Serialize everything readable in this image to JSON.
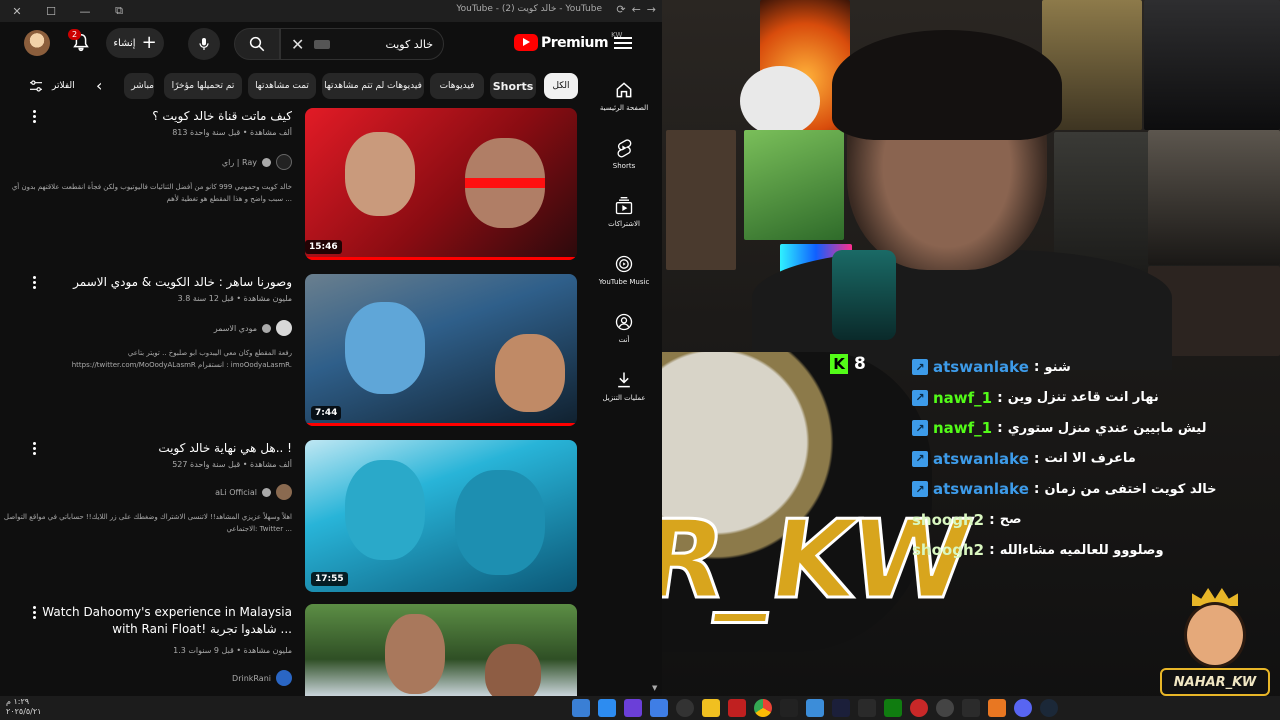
{
  "browser": {
    "window_title": "YouTube - خالد كويت (2) - YouTube"
  },
  "masthead": {
    "notification_count": "2",
    "create_label": "إنشاء",
    "search_query": "خالد كويت",
    "logo_text": "Premium",
    "logo_region": "KW"
  },
  "filters": {
    "filters_label": "الفلاتر",
    "chips": [
      "الكل",
      "Shorts",
      "فيديوهات",
      "فيديوهات لم تتم مشاهدتها",
      "تمت مشاهدتها",
      "تم تحميلها مؤخرًا",
      "مباشر"
    ]
  },
  "rail": {
    "items": [
      {
        "label": "الصفحة الرئيسية",
        "icon": "home-icon"
      },
      {
        "label": "Shorts",
        "icon": "shorts-icon"
      },
      {
        "label": "الاشتراكات",
        "icon": "subscriptions-icon"
      },
      {
        "label": "YouTube Music",
        "icon": "music-icon"
      },
      {
        "label": "أنت",
        "icon": "you-icon"
      },
      {
        "label": "عمليات التنزيل",
        "icon": "download-icon"
      }
    ]
  },
  "results": [
    {
      "title": "كيف ماتت قناة خالد كويت ؟",
      "meta": "813 ألف مشاهدة • قبل سنة واحدة",
      "channel": "راي | Ray",
      "desc": "خالد كويت وحمومي 999 كانو من أفضل الثنائيات فاليوتيوب ولكن فجأة انقطعت علاقتهم بدون أي سبب واضح و هذا المقطع هو تغطية لأهم ...",
      "duration": "15:46",
      "colors": [
        "#c4101a",
        "#ff3b3b"
      ]
    },
    {
      "title": "وصورنا ساهر : خالد الكويت & مودي الاسمر",
      "meta": "3.8 مليون مشاهدة • قبل 12 سنة",
      "channel": "مودي الاسمر",
      "desc": "رفعة المقطع وكان معي اليبدوب ابو صلبوخ .. تويتر بتاعي https://twitter.com/MoOodyALasmR انستقرام : imoOodyaLasmR.",
      "duration": "7:44",
      "colors": [
        "#3a8fd1",
        "#1d2b3a"
      ]
    },
    {
      "title": "هل هي نهاية خالد كويت.. !",
      "meta": "527 ألف مشاهدة • قبل سنة واحدة",
      "channel": "aLi Official",
      "desc": "اهلاً وسهلاً عزيزي المشاهد!! لاتنسى الاشتراك وضغطك على زر اللايك!! حساباتي في مواقع التواصل الاجتماعي: Twitter ...",
      "duration": "17:55",
      "colors": [
        "#1fa3c9",
        "#0b3a5a"
      ]
    },
    {
      "title": "Watch Dahoomy's experience in Malaysia with Rani Float! شاهدوا تجربة ...",
      "meta": "1.3 مليون مشاهدة • قبل 9 سنوات",
      "channel": "DrinkRani",
      "desc": "",
      "duration": "",
      "colors": [
        "#4e7d3a",
        "#c9d9e3"
      ]
    }
  ],
  "stream": {
    "kick_viewers": "8",
    "brand_text": "R_KW",
    "mascot_name": "NAHAR_KW",
    "chat": [
      {
        "user": "atswanlake",
        "message": "شنو",
        "color": "#3d9be9",
        "badge": true
      },
      {
        "user": "nawf_1",
        "message": "نهار انت قاعد تنزل وين",
        "color": "#53fc18",
        "badge": true
      },
      {
        "user": "nawf_1",
        "message": "ليش مابيين عندي منزل ستوري",
        "color": "#53fc18",
        "badge": true
      },
      {
        "user": "atswanlake",
        "message": "ماعرف الا انت",
        "color": "#3d9be9",
        "badge": true
      },
      {
        "user": "atswanlake",
        "message": "خالد كويت اختفى من زمان",
        "color": "#3d9be9",
        "badge": true
      },
      {
        "user": "shoogh2",
        "message": "صح",
        "color": "#d9f7c0",
        "badge": false
      },
      {
        "user": "shoogh2",
        "message": "وصلووو للعالميه مشاءالله",
        "color": "#d9f7c0",
        "badge": false
      }
    ]
  },
  "taskbar": {
    "time": "١:٢٩ م",
    "date": "٢٠٢٥/٥/٢١"
  }
}
